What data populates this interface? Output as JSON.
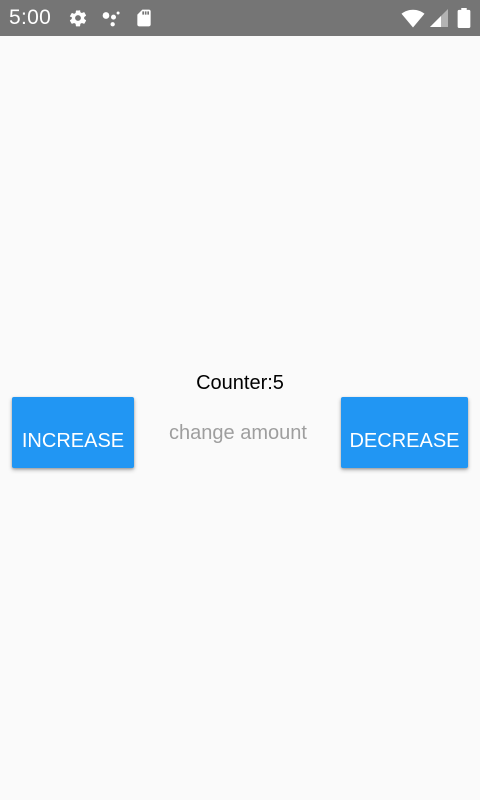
{
  "status_bar": {
    "time": "5:00",
    "icons": [
      "gear-icon",
      "assistant-dots-icon",
      "sd-card-icon",
      "wifi-icon",
      "signal-icon",
      "battery-icon"
    ]
  },
  "counter": {
    "label": "Counter:5"
  },
  "buttons": {
    "increase_label": "INCREASE",
    "decrease_label": "DECREASE"
  },
  "amount_input": {
    "value": "",
    "placeholder": "change amount"
  },
  "colors": {
    "status_bar": "#757575",
    "background": "#fafafa",
    "button": "#2196f3",
    "button_text": "#ffffff",
    "placeholder": "#9e9e9e"
  }
}
